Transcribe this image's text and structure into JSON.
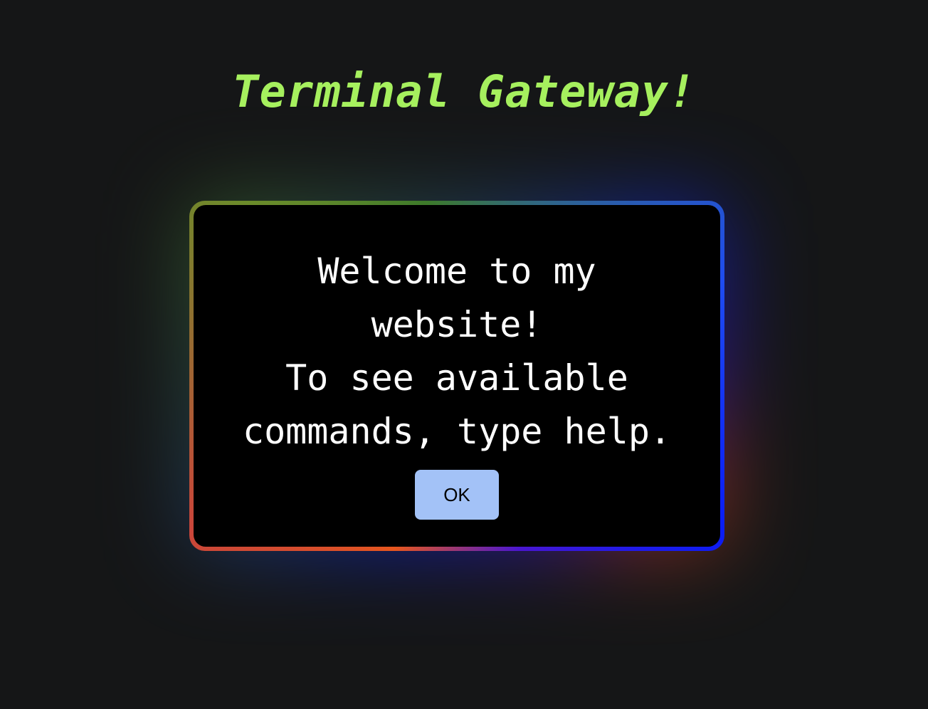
{
  "header": {
    "title": "Terminal Gateway!"
  },
  "dialog": {
    "line1": "Welcome to my website!",
    "line2": "To see available commands, type help.",
    "ok_label": "OK"
  },
  "colors": {
    "background": "#151617",
    "title": "#a6f05e",
    "dialog_background": "#000000",
    "dialog_text": "#ffffff",
    "button_background": "#a3c2f7",
    "border_green": "#4c8a24",
    "border_blue": "#0a1df5",
    "border_purple": "#4a16d0",
    "border_red": "#e6561e"
  }
}
